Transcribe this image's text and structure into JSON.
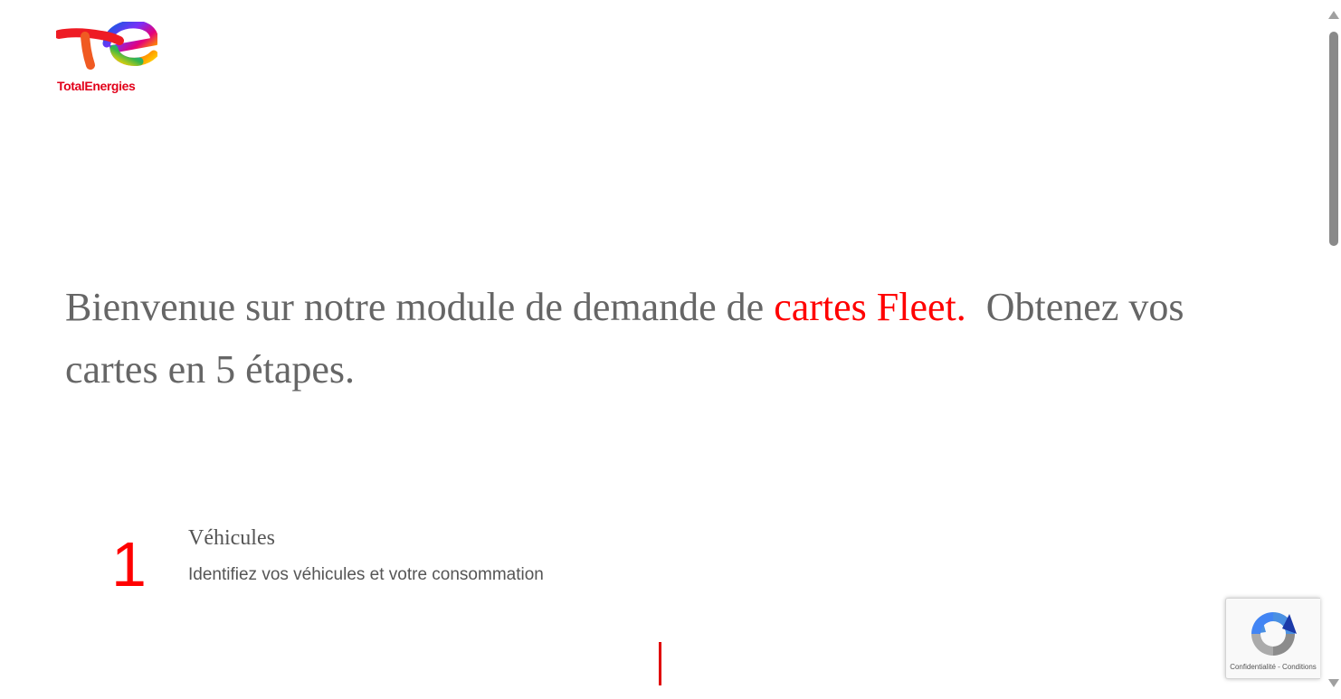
{
  "brand": {
    "logo_text": "TotalEnergies",
    "logo_color": "#e2001a"
  },
  "hero": {
    "intro": "Bienvenue sur notre module de demande de ",
    "highlight": "cartes Fleet.",
    "outro": "  Obtenez vos cartes en 5 étapes."
  },
  "steps": [
    {
      "number": "1",
      "title": "Véhicules",
      "description": "Identifiez vos véhicules et votre consommation"
    }
  ],
  "recaptcha": {
    "privacy_label": "Confidentialité",
    "separator": " - ",
    "terms_label": "Conditions",
    "icon": "recaptcha-logo-icon"
  },
  "colors": {
    "accent": "#ff0000",
    "text": "#666666"
  }
}
